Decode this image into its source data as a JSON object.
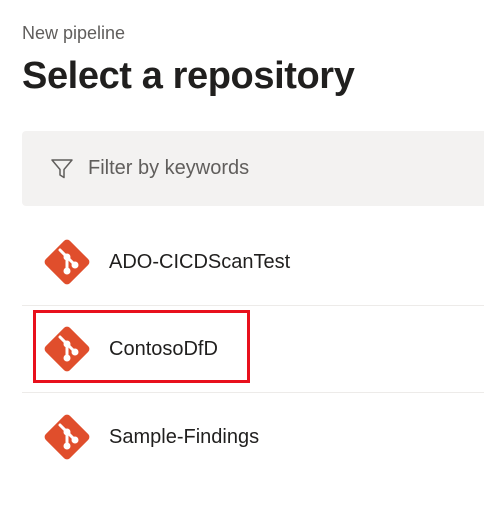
{
  "header": {
    "breadcrumb": "New pipeline",
    "title": "Select a repository"
  },
  "filter": {
    "icon": "filter-icon",
    "placeholder": "Filter by keywords"
  },
  "repositories": [
    {
      "name": "ADO-CICDScanTest",
      "icon": "git-repo-icon"
    },
    {
      "name": "ContosoDfD",
      "icon": "git-repo-icon",
      "highlighted": true
    },
    {
      "name": "Sample-Findings",
      "icon": "git-repo-icon"
    }
  ],
  "colors": {
    "git_icon": "#e04e2c",
    "highlight_box": "#e8101c",
    "filter_background": "#f3f2f1"
  }
}
